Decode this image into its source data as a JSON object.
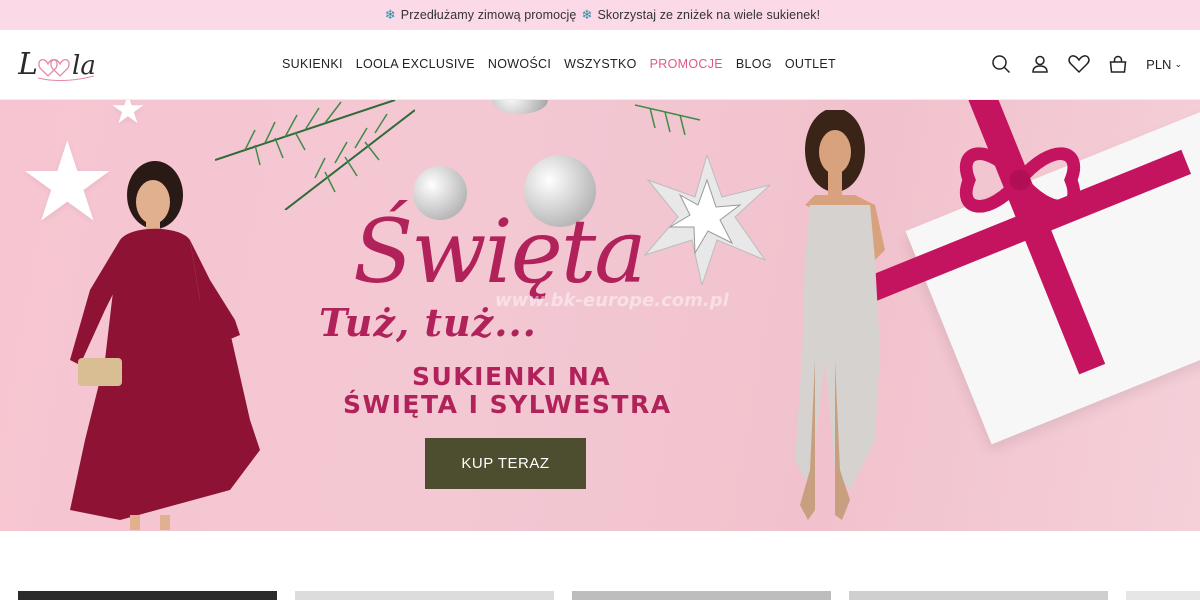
{
  "announcement": {
    "text": "Przedłużamy zimową promocję",
    "text2": "Skorzystaj ze zniżek na wiele sukienek!",
    "icon": "snowflake-icon"
  },
  "logo": {
    "text": "Loola"
  },
  "nav": {
    "items": [
      {
        "label": "SUKIENKI"
      },
      {
        "label": "LOOLA EXCLUSIVE"
      },
      {
        "label": "NOWOŚCI"
      },
      {
        "label": "WSZYSTKO"
      },
      {
        "label": "PROMOCJE",
        "highlight": "#e2568d"
      },
      {
        "label": "BLOG"
      },
      {
        "label": "OUTLET"
      }
    ]
  },
  "header_icons": [
    "search-icon",
    "account-icon",
    "heart-icon",
    "cart-icon"
  ],
  "currency": {
    "label": "PLN"
  },
  "hero": {
    "headline": "Święta",
    "tagline": "Tuż, tuż...",
    "watermark": "www.bk-europe.com.pl",
    "subline1": "SUKIENKI NA",
    "subline2": "ŚWIĘTA I SYLWESTRA",
    "cta_label": "KUP TERAZ",
    "accent": "#b1225a",
    "cta_color": "#4d4d2f"
  }
}
